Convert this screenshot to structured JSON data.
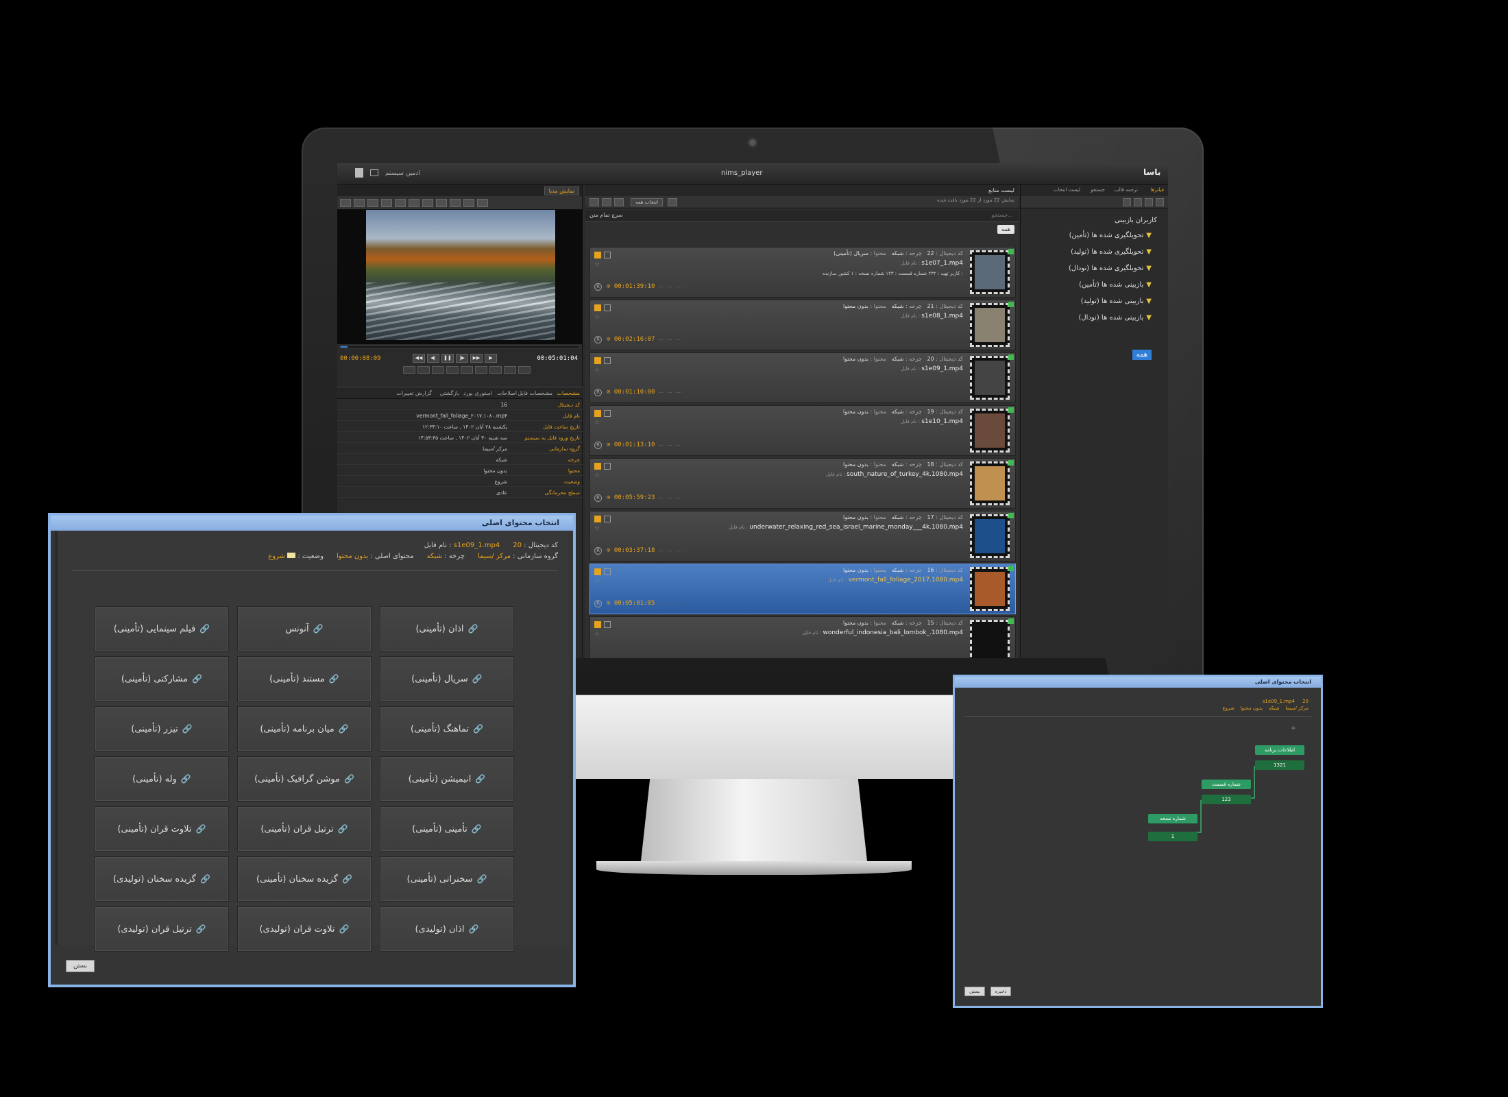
{
  "window": {
    "app_title": "nims_player",
    "user_label": "ادمین سیستم",
    "logo_text": "باسا"
  },
  "player": {
    "tab_label": "نمایش مدیا",
    "time_current": "00:00:08:09",
    "time_total": "00:05:01:04",
    "progress": 0.03,
    "prop_tabs": [
      "مشخصات",
      "مشخصات فایل",
      "اصلاحات",
      "استوری بورد",
      "بازگشتی",
      "گزارش تغییرات"
    ],
    "props": [
      {
        "k": "کد دیجیتال",
        "v": "16"
      },
      {
        "k": "نام فایل",
        "v": "vermont_fall_foliage_۲۰۱۷.۱۰۸۰.mp۴"
      },
      {
        "k": "تاریخ ساخت فایل",
        "v": "یکشنبه ۲۸ آبان ۱۴۰۲ , ساعت ۱۲:۳۴:۱۰"
      },
      {
        "k": "تاریخ ورود فایل به سیستم",
        "v": "سه شنبه ۳۰ آبان ۱۴۰۲ , ساعت ۱۴:۵۳:۳۵"
      },
      {
        "k": "گروه سازمانی",
        "v": "مرکز /سیما"
      },
      {
        "k": "چرخه",
        "v": "شبکه"
      },
      {
        "k": "محتوا",
        "v": "بدون محتوا"
      },
      {
        "k": "وضعیت",
        "v": "شروع"
      },
      {
        "k": "سطح محرمانگی",
        "v": "عادی"
      }
    ]
  },
  "list": {
    "header_title": "لیست منابع",
    "header_sub": "نمایش 22 مورد از 22 مورد یافت شده",
    "select_all": "انتخاب همه",
    "advanced_search": "سرچ تمام متن",
    "search_placeholder": "جستجو...",
    "filter_chip": "همه",
    "items": [
      {
        "code": "22",
        "cycle": "شبکه",
        "content": "سریال (تأمینی)",
        "file": "s1e07_1.mp4",
        "extra": "کاربر تهیه : ۲۳۲   شماره قسمت : ۱۲۳   شماره نسخه : ۱   کشور سازنده :",
        "duration": "00:01:39:10",
        "selected": false,
        "thumb": "#5a6a78"
      },
      {
        "code": "21",
        "cycle": "شبکه",
        "content": "بدون محتوا",
        "file": "s1e08_1.mp4",
        "extra": "",
        "duration": "00:02:16:07",
        "selected": false,
        "thumb": "#8a8270"
      },
      {
        "code": "20",
        "cycle": "شبکه",
        "content": "بدون محتوا",
        "file": "s1e09_1.mp4",
        "extra": "",
        "duration": "00:01:10:00",
        "selected": false,
        "thumb": "#444444"
      },
      {
        "code": "19",
        "cycle": "شبکه",
        "content": "بدون محتوا",
        "file": "s1e10_1.mp4",
        "extra": "",
        "duration": "00:01:13:10",
        "selected": false,
        "thumb": "#6a4a3a"
      },
      {
        "code": "18",
        "cycle": "شبکه",
        "content": "بدون محتوا",
        "file": "south_nature_of_turkey_4k.1080.mp4",
        "extra": "",
        "duration": "00:05:59:23",
        "selected": false,
        "thumb": "#c09050"
      },
      {
        "code": "17",
        "cycle": "شبکه",
        "content": "بدون محتوا",
        "file": "underwater_relaxing_red_sea_israel_marine_monday___4k.1080.mp4",
        "extra": "",
        "duration": "00:03:37:18",
        "selected": false,
        "thumb": "#1d4f8a"
      },
      {
        "code": "16",
        "cycle": "شبکه",
        "content": "بدون محتوا",
        "file": "vermont_fall_foliage_2017.1080.mp4",
        "extra": "",
        "duration": "00:05:01:05",
        "selected": true,
        "thumb": "#a85a2a"
      },
      {
        "code": "15",
        "cycle": "شبکه",
        "content": "بدون محتوا",
        "file": "wonderful_indonesia_bali_lombok_.1080.mp4",
        "extra": "",
        "duration": "",
        "selected": false,
        "thumb": "#111111"
      }
    ]
  },
  "tree": {
    "tabs": [
      "فیلترها",
      "ترجمه قالب",
      "جستجو",
      "لیست انتخاب"
    ],
    "root": "کاربران بازبینی",
    "items": [
      "تحویلگیری شده ها (تأمین)",
      "تحویلگیری شده ها (تولید)",
      "تحویلگیری شده ها (نودال)",
      "بازبینی شده ها (تأمین)",
      "بازبینی شده ها (تولید)",
      "بازبینی شده ها (نودال)"
    ],
    "all_label": "همه"
  },
  "dialog1": {
    "title": "انتخاب محتوای اصلی",
    "file_label": "نام فایل :",
    "file_value": "s1e09_1.mp4",
    "code_label": "کد دیجیتال :",
    "code_value": "20",
    "group_label": "گروه سازمانی :",
    "group_value": "مرکز /سیما",
    "cycle_label": "چرخه :",
    "cycle_value": "شبکه",
    "content_label": "محتوای اصلی :",
    "content_value": "بدون محتوا",
    "status_label": "وضعیت :",
    "status_value": "شروع",
    "buttons": [
      "اذان (تأمینی)",
      "آنونس",
      "فیلم سینمایی (تأمینی)",
      "سریال (تأمینی)",
      "مستند (تأمینی)",
      "مشارکتی (تأمینی)",
      "تماهنگ (تأمینی)",
      "میان برنامه (تأمینی)",
      "تیزر (تأمینی)",
      "انیمیشن (تأمینی)",
      "موشن گرافیک (تأمینی)",
      "وله (تأمینی)",
      "تأمینی (تأمینی)",
      "ترتیل قران (تأمینی)",
      "تلاوت قران (تأمینی)",
      "سخنرانی (تأمینی)",
      "گزیده سخنان (تأمینی)",
      "گزیده سخنان (تولیدی)",
      "اذان (تولیدی)",
      "تلاوت قران (تولیدی)",
      "ترتیل قران (تولیدی)"
    ],
    "close_label": "بستن"
  },
  "dialog2": {
    "title": "انتخاب محتوای اصلی",
    "file_value": "s1e09_1.mp4",
    "code_value": "20",
    "group_value": "مرکز /سیما",
    "cycle_value": "شبکه",
    "content_value": "بدون محتوا",
    "status_value": "شروع",
    "nodes": [
      {
        "label": "اطلاعات برنامه",
        "value": "1321"
      },
      {
        "label": "شماره قسمت",
        "value": "123"
      },
      {
        "label": "شماره نسخه",
        "value": "1"
      }
    ],
    "save_label": "ذخیره",
    "close_label": "بستن"
  }
}
